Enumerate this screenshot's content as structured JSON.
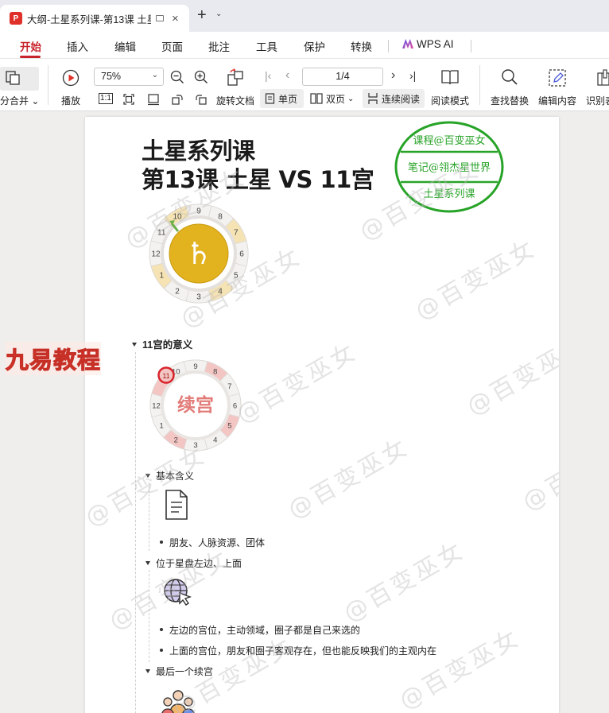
{
  "tab": {
    "title": "大纲-土星系列课-第13课 土星",
    "close": "×"
  },
  "new_tab": "+",
  "tab_menu": "⌄",
  "menu": {
    "items": [
      "开始",
      "插入",
      "编辑",
      "页面",
      "批注",
      "工具",
      "保护",
      "转换"
    ],
    "wps_ai": "WPS AI"
  },
  "toolbar": {
    "split_merge": "分合并",
    "play": "播放",
    "zoom": "75%",
    "page": "1/4",
    "rotate": "旋转文档",
    "single": "单页",
    "double": "双页",
    "continuous": "连续阅读",
    "read_mode": "阅读模式",
    "find_replace": "查找替换",
    "edit_content": "编辑内容",
    "recognize": "识别表",
    "fit_1_1": "1:1"
  },
  "doc": {
    "title_line1": "土星系列课",
    "title_line2": "第13课 土星 VS 11宫",
    "saturn_symbol": "♄",
    "wheel_numbers": [
      "10",
      "9",
      "8",
      "7",
      "6",
      "5",
      "4",
      "3",
      "2",
      "1",
      "12",
      "11"
    ],
    "stamp": {
      "line1": "课程@百变巫女",
      "line2": "笔记@翎杰星世界",
      "line3": "土星系列课",
      "color": "#27a327"
    },
    "section_heading": "11宫的意义",
    "succedent_label": "续宫",
    "basic_meaning": "基本含义",
    "basic_meaning_item": "朋友、人脉资源、团体",
    "position": "位于星盘左边、上面",
    "position_items": [
      "左边的宫位，主动领域，圈子都是自己来选的",
      "上面的宫位，朋友和圈子客观存在，但也能反映我们的主观内在"
    ],
    "last_succedent": "最后一个续宫",
    "watermark": "@百变巫女"
  },
  "overlay_brand": "九易教程",
  "colors": {
    "accent": "#c8242b",
    "stamp_green": "#27a327",
    "saturn_gold": "#e2b21f",
    "succedent_pink": "#f3c6c4",
    "house_cream": "#f6e3b4"
  }
}
